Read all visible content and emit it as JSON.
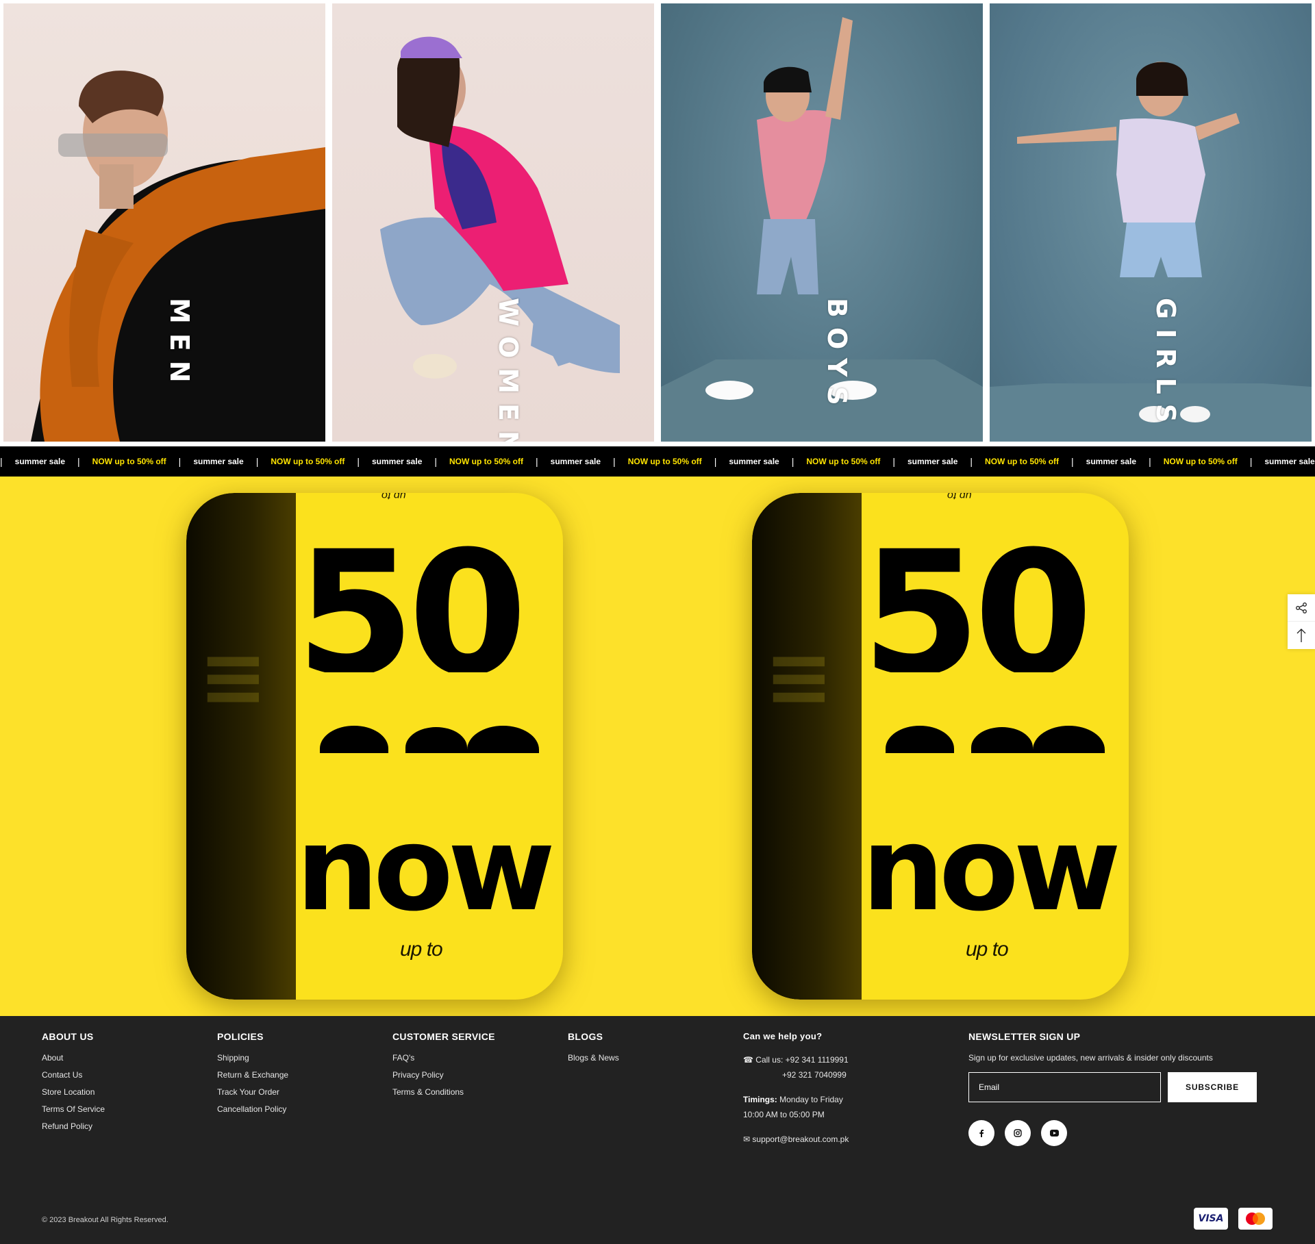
{
  "categories": [
    {
      "label": "MEN"
    },
    {
      "label": "WOMEN"
    },
    {
      "label": "BOYS"
    },
    {
      "label": "GIRLS"
    }
  ],
  "marquee": {
    "items": [
      "summer sale",
      "NOW up to 50% off",
      "summer sale",
      "NOW up to 50% off",
      "summer sale",
      "NOW up to 50% off",
      "summer sale",
      "NOW up to 50% off",
      "summer sale",
      "NOW up to 50% off",
      "summer sale",
      "NOW up to 50% off",
      "summer sale",
      "NOW up to 50% off",
      "summer sale",
      "NOW up to 50% off",
      "summer sale"
    ],
    "separator": "|"
  },
  "banner": {
    "big_number": "50",
    "word": "now",
    "upto": "up to"
  },
  "footer": {
    "about": {
      "heading": "ABOUT US",
      "links": [
        "About",
        "Contact Us",
        "Store Location",
        "Terms Of Service",
        "Refund Policy"
      ]
    },
    "policies": {
      "heading": "POLICIES",
      "links": [
        "Shipping",
        "Return & Exchange",
        "Track Your Order",
        "Cancellation Policy"
      ]
    },
    "service": {
      "heading": "CUSTOMER SERVICE",
      "links": [
        "FAQ's",
        "Privacy Policy",
        "Terms & Conditions"
      ]
    },
    "blogs": {
      "heading": "BLOGS",
      "links": [
        "Blogs & News"
      ]
    },
    "help": {
      "heading": "Can we help you?",
      "call_label": "Call us:",
      "phone1": "+92 341 1119991",
      "phone2": "+92 321 7040999",
      "timings_label": "Timings:",
      "timings_days": "Monday to Friday",
      "timings_hours": "10:00 AM to 05:00 PM",
      "email": "support@breakout.com.pk"
    },
    "newsletter": {
      "heading": "NEWSLETTER SIGN UP",
      "text": "Sign up for exclusive updates, new arrivals & insider only discounts",
      "placeholder": "Email",
      "button": "SUBSCRIBE"
    },
    "copyright": "© 2023 Breakout All Rights Reserved.",
    "payments": [
      "VISA",
      "mastercard"
    ]
  },
  "colors": {
    "banner_yellow": "#fde12a",
    "footer_bg": "#222222",
    "marquee_accent": "#ffe400"
  },
  "icons": [
    "share-icon",
    "arrow-up-icon",
    "facebook-icon",
    "instagram-icon",
    "youtube-icon",
    "phone-icon",
    "mail-icon"
  ]
}
